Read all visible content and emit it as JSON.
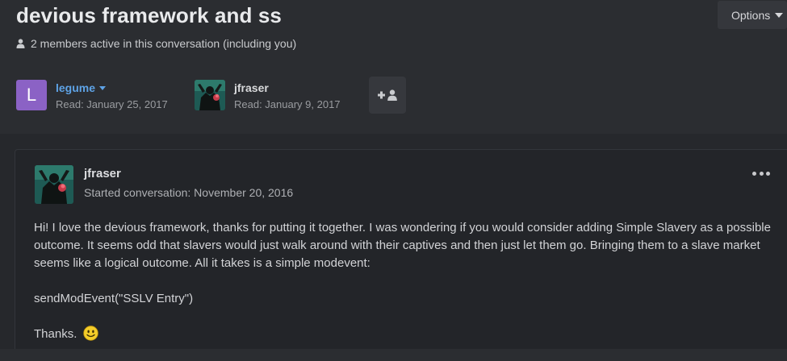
{
  "conversation": {
    "title": "devious framework and ss",
    "options_label": "Options",
    "active_members_text": "2 members active in this conversation (including you)"
  },
  "members": [
    {
      "name": "legume",
      "avatar_letter": "L",
      "read": "Read: January 25, 2017",
      "accent": "#8b62c5",
      "name_color": "#5ea3e6"
    },
    {
      "name": "jfraser",
      "read": "Read: January 9, 2017"
    }
  ],
  "icons": {
    "active_members": "user-icon",
    "add_participant": "add-user-icon",
    "post_menu": "ellipsis-icon",
    "smiley": "smiley-emoji"
  },
  "post": {
    "author": "jfraser",
    "started": "Started conversation: November 20, 2016",
    "paragraphs": [
      "Hi! I love the devious framework, thanks for putting it together. I was wondering if you would consider adding Simple Slavery as a possible outcome. It seems odd that slavers would just walk around with their captives and then just let them go. Bringing them to a slave market seems like a logical outcome. All it takes is a simple modevent:",
      "sendModEvent(\"SSLV Entry\")",
      "Thanks."
    ]
  }
}
